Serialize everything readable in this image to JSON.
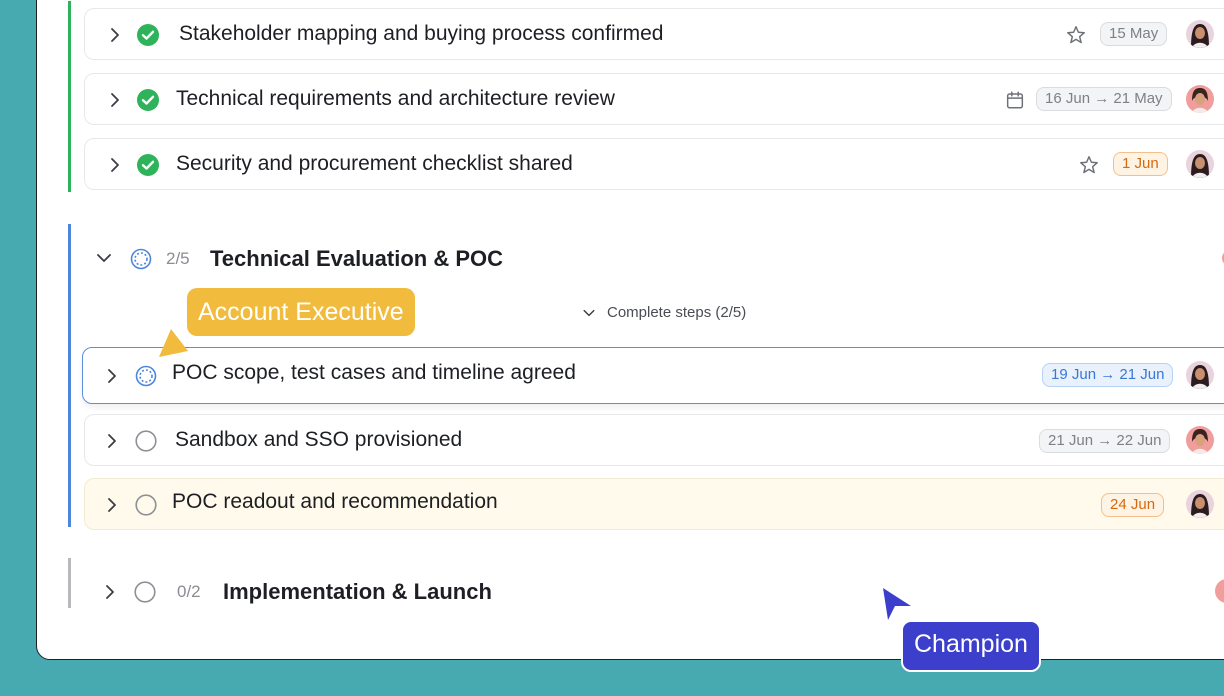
{
  "colors": {
    "background": "#47aab0",
    "done_green": "#2fb35a",
    "stage_blue": "#4d86dd",
    "ae_tag": "#f1bb3e",
    "champion_tag": "#3b3fcc"
  },
  "done_tasks": [
    {
      "title": "Stakeholder mapping and buying process confirmed",
      "icon": "star-icon",
      "date": "15 May",
      "date_style": "gray"
    },
    {
      "title": "Technical requirements and architecture review",
      "icon": "calendar-icon",
      "date": "16 Jun → 21 May",
      "date_style": "gray"
    },
    {
      "title": "Security and procurement checklist shared",
      "icon": "star-icon",
      "date": "1 Jun",
      "date_style": "orange"
    }
  ],
  "stage_poc": {
    "count": "2/5",
    "title": "Technical Evaluation & POC",
    "complete_steps": "Complete steps (2/5)",
    "tasks": [
      {
        "title": "POC scope, test cases and timeline agreed",
        "date": "19 Jun → 21 Jun",
        "date_style": "blue",
        "status": "in-progress"
      },
      {
        "title": "Sandbox and SSO provisioned",
        "date": "21 Jun → 22 Jun",
        "date_style": "gray",
        "status": "todo"
      },
      {
        "title": "POC readout and recommendation",
        "date": "24 Jun",
        "date_style": "orange",
        "status": "todo"
      }
    ]
  },
  "stage_impl": {
    "count": "0/2",
    "title": "Implementation & Launch"
  },
  "tags": {
    "account_executive": "Account Executive",
    "champion": "Champion"
  }
}
